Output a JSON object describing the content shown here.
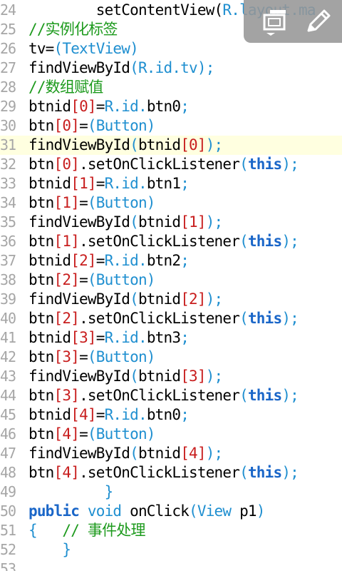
{
  "lines": [
    {
      "num": "24",
      "segments": [
        {
          "t": "        setContentView(",
          "c": "plain"
        },
        {
          "t": "R.layout.ma",
          "c": "blue"
        }
      ]
    },
    {
      "num": "25",
      "segments": [
        {
          "t": "//实例化标签",
          "c": "green"
        }
      ]
    },
    {
      "num": "26",
      "segments": [
        {
          "t": "tv=",
          "c": "plain"
        },
        {
          "t": "(",
          "c": "blue"
        },
        {
          "t": "TextView",
          "c": "blue"
        },
        {
          "t": ")",
          "c": "blue"
        }
      ]
    },
    {
      "num": "27",
      "segments": [
        {
          "t": "findViewById",
          "c": "plain"
        },
        {
          "t": "(",
          "c": "blue"
        },
        {
          "t": "R.id.tv",
          "c": "blue"
        },
        {
          "t": ");",
          "c": "blue"
        }
      ]
    },
    {
      "num": "28",
      "segments": [
        {
          "t": "//数组赋值",
          "c": "green"
        }
      ]
    },
    {
      "num": "29",
      "segments": [
        {
          "t": "btnid",
          "c": "plain"
        },
        {
          "t": "[",
          "c": "red"
        },
        {
          "t": "0",
          "c": "red"
        },
        {
          "t": "]",
          "c": "red"
        },
        {
          "t": "=",
          "c": "plain"
        },
        {
          "t": "R.id.",
          "c": "blue"
        },
        {
          "t": "btn0",
          "c": "plain"
        },
        {
          "t": ";",
          "c": "blue"
        }
      ]
    },
    {
      "num": "30",
      "segments": [
        {
          "t": "btn",
          "c": "plain"
        },
        {
          "t": "[",
          "c": "red"
        },
        {
          "t": "0",
          "c": "red"
        },
        {
          "t": "]",
          "c": "red"
        },
        {
          "t": "=",
          "c": "plain"
        },
        {
          "t": "(Button)",
          "c": "blue"
        }
      ]
    },
    {
      "num": "31",
      "highlight": true,
      "segments": [
        {
          "t": "findViewById",
          "c": "plain"
        },
        {
          "t": "(",
          "c": "blue"
        },
        {
          "t": "btnid",
          "c": "plain"
        },
        {
          "t": "[",
          "c": "red"
        },
        {
          "t": "0",
          "c": "red"
        },
        {
          "t": "]",
          "c": "red"
        },
        {
          "t": ");",
          "c": "blue"
        }
      ]
    },
    {
      "num": "32",
      "segments": [
        {
          "t": "btn",
          "c": "plain"
        },
        {
          "t": "[",
          "c": "red"
        },
        {
          "t": "0",
          "c": "red"
        },
        {
          "t": "]",
          "c": "red"
        },
        {
          "t": ".setOnClickListener",
          "c": "plain"
        },
        {
          "t": "(",
          "c": "blue"
        },
        {
          "t": "this",
          "c": "kw"
        },
        {
          "t": ");",
          "c": "blue"
        }
      ]
    },
    {
      "num": "33",
      "segments": [
        {
          "t": "btnid",
          "c": "plain"
        },
        {
          "t": "[",
          "c": "red"
        },
        {
          "t": "1",
          "c": "red"
        },
        {
          "t": "]",
          "c": "red"
        },
        {
          "t": "=",
          "c": "plain"
        },
        {
          "t": "R.id.",
          "c": "blue"
        },
        {
          "t": "btn1",
          "c": "plain"
        },
        {
          "t": ";",
          "c": "blue"
        }
      ]
    },
    {
      "num": "34",
      "segments": [
        {
          "t": "btn",
          "c": "plain"
        },
        {
          "t": "[",
          "c": "red"
        },
        {
          "t": "1",
          "c": "red"
        },
        {
          "t": "]",
          "c": "red"
        },
        {
          "t": "=",
          "c": "plain"
        },
        {
          "t": "(Button)",
          "c": "blue"
        }
      ]
    },
    {
      "num": "35",
      "segments": [
        {
          "t": "findViewById",
          "c": "plain"
        },
        {
          "t": "(",
          "c": "blue"
        },
        {
          "t": "btnid",
          "c": "plain"
        },
        {
          "t": "[",
          "c": "red"
        },
        {
          "t": "1",
          "c": "red"
        },
        {
          "t": "]",
          "c": "red"
        },
        {
          "t": ");",
          "c": "blue"
        }
      ]
    },
    {
      "num": "36",
      "segments": [
        {
          "t": "btn",
          "c": "plain"
        },
        {
          "t": "[",
          "c": "red"
        },
        {
          "t": "1",
          "c": "red"
        },
        {
          "t": "]",
          "c": "red"
        },
        {
          "t": ".setOnClickListener",
          "c": "plain"
        },
        {
          "t": "(",
          "c": "blue"
        },
        {
          "t": "this",
          "c": "kw"
        },
        {
          "t": ");",
          "c": "blue"
        }
      ]
    },
    {
      "num": "37",
      "segments": [
        {
          "t": "btnid",
          "c": "plain"
        },
        {
          "t": "[",
          "c": "red"
        },
        {
          "t": "2",
          "c": "red"
        },
        {
          "t": "]",
          "c": "red"
        },
        {
          "t": "=",
          "c": "plain"
        },
        {
          "t": "R.id.",
          "c": "blue"
        },
        {
          "t": "btn2",
          "c": "plain"
        },
        {
          "t": ";",
          "c": "blue"
        }
      ]
    },
    {
      "num": "38",
      "segments": [
        {
          "t": "btn",
          "c": "plain"
        },
        {
          "t": "[",
          "c": "red"
        },
        {
          "t": "2",
          "c": "red"
        },
        {
          "t": "]",
          "c": "red"
        },
        {
          "t": "=",
          "c": "plain"
        },
        {
          "t": "(Button)",
          "c": "blue"
        }
      ]
    },
    {
      "num": "39",
      "segments": [
        {
          "t": "findViewById",
          "c": "plain"
        },
        {
          "t": "(",
          "c": "blue"
        },
        {
          "t": "btnid",
          "c": "plain"
        },
        {
          "t": "[",
          "c": "red"
        },
        {
          "t": "2",
          "c": "red"
        },
        {
          "t": "]",
          "c": "red"
        },
        {
          "t": ");",
          "c": "blue"
        }
      ]
    },
    {
      "num": "40",
      "segments": [
        {
          "t": "btn",
          "c": "plain"
        },
        {
          "t": "[",
          "c": "red"
        },
        {
          "t": "2",
          "c": "red"
        },
        {
          "t": "]",
          "c": "red"
        },
        {
          "t": ".setOnClickListener",
          "c": "plain"
        },
        {
          "t": "(",
          "c": "blue"
        },
        {
          "t": "this",
          "c": "kw"
        },
        {
          "t": ");",
          "c": "blue"
        }
      ]
    },
    {
      "num": "41",
      "segments": [
        {
          "t": "btnid",
          "c": "plain"
        },
        {
          "t": "[",
          "c": "red"
        },
        {
          "t": "3",
          "c": "red"
        },
        {
          "t": "]",
          "c": "red"
        },
        {
          "t": "=",
          "c": "plain"
        },
        {
          "t": "R.id.",
          "c": "blue"
        },
        {
          "t": "btn3",
          "c": "plain"
        },
        {
          "t": ";",
          "c": "blue"
        }
      ]
    },
    {
      "num": "42",
      "segments": [
        {
          "t": "btn",
          "c": "plain"
        },
        {
          "t": "[",
          "c": "red"
        },
        {
          "t": "3",
          "c": "red"
        },
        {
          "t": "]",
          "c": "red"
        },
        {
          "t": "=",
          "c": "plain"
        },
        {
          "t": "(Button)",
          "c": "blue"
        }
      ]
    },
    {
      "num": "43",
      "segments": [
        {
          "t": "findViewById",
          "c": "plain"
        },
        {
          "t": "(",
          "c": "blue"
        },
        {
          "t": "btnid",
          "c": "plain"
        },
        {
          "t": "[",
          "c": "red"
        },
        {
          "t": "3",
          "c": "red"
        },
        {
          "t": "]",
          "c": "red"
        },
        {
          "t": ");",
          "c": "blue"
        }
      ]
    },
    {
      "num": "44",
      "segments": [
        {
          "t": "btn",
          "c": "plain"
        },
        {
          "t": "[",
          "c": "red"
        },
        {
          "t": "3",
          "c": "red"
        },
        {
          "t": "]",
          "c": "red"
        },
        {
          "t": ".setOnClickListener",
          "c": "plain"
        },
        {
          "t": "(",
          "c": "blue"
        },
        {
          "t": "this",
          "c": "kw"
        },
        {
          "t": ");",
          "c": "blue"
        }
      ]
    },
    {
      "num": "45",
      "segments": [
        {
          "t": "btnid",
          "c": "plain"
        },
        {
          "t": "[",
          "c": "red"
        },
        {
          "t": "4",
          "c": "red"
        },
        {
          "t": "]",
          "c": "red"
        },
        {
          "t": "=",
          "c": "plain"
        },
        {
          "t": "R.id.",
          "c": "blue"
        },
        {
          "t": "btn0",
          "c": "plain"
        },
        {
          "t": ";",
          "c": "blue"
        }
      ]
    },
    {
      "num": "46",
      "segments": [
        {
          "t": "btn",
          "c": "plain"
        },
        {
          "t": "[",
          "c": "red"
        },
        {
          "t": "4",
          "c": "red"
        },
        {
          "t": "]",
          "c": "red"
        },
        {
          "t": "=",
          "c": "plain"
        },
        {
          "t": "(Button)",
          "c": "blue"
        }
      ]
    },
    {
      "num": "47",
      "segments": [
        {
          "t": "findViewById",
          "c": "plain"
        },
        {
          "t": "(",
          "c": "blue"
        },
        {
          "t": "btnid",
          "c": "plain"
        },
        {
          "t": "[",
          "c": "red"
        },
        {
          "t": "4",
          "c": "red"
        },
        {
          "t": "]",
          "c": "red"
        },
        {
          "t": ");",
          "c": "blue"
        }
      ]
    },
    {
      "num": "48",
      "segments": [
        {
          "t": "btn",
          "c": "plain"
        },
        {
          "t": "[",
          "c": "red"
        },
        {
          "t": "4",
          "c": "red"
        },
        {
          "t": "]",
          "c": "red"
        },
        {
          "t": ".setOnClickListener",
          "c": "plain"
        },
        {
          "t": "(",
          "c": "blue"
        },
        {
          "t": "this",
          "c": "kw"
        },
        {
          "t": ");",
          "c": "blue"
        }
      ]
    },
    {
      "num": "49",
      "segments": [
        {
          "t": "         }",
          "c": "blue"
        }
      ]
    },
    {
      "num": "50",
      "segments": [
        {
          "t": "public",
          "c": "kw"
        },
        {
          "t": " ",
          "c": "plain"
        },
        {
          "t": "void",
          "c": "blue"
        },
        {
          "t": " onClick",
          "c": "plain"
        },
        {
          "t": "(",
          "c": "blue"
        },
        {
          "t": "View",
          "c": "blue"
        },
        {
          "t": " p1",
          "c": "plain"
        },
        {
          "t": ")",
          "c": "blue"
        }
      ]
    },
    {
      "num": "51",
      "segments": [
        {
          "t": "{",
          "c": "blue"
        },
        {
          "t": "   // 事件处理",
          "c": "green"
        }
      ]
    },
    {
      "num": "52",
      "segments": [
        {
          "t": "    }",
          "c": "blue"
        }
      ]
    },
    {
      "num": "53",
      "segments": []
    }
  ],
  "toolbar": {
    "icons": [
      "screen-switch-icon",
      "pencil-edit-icon"
    ]
  },
  "colors": {
    "line_number": "#a6a6a6",
    "blue": "#1f8fd0",
    "red": "#c81e1e",
    "green": "#1d9a1d",
    "keyword": "#1a66c8",
    "current_line": "#ffffe0"
  }
}
